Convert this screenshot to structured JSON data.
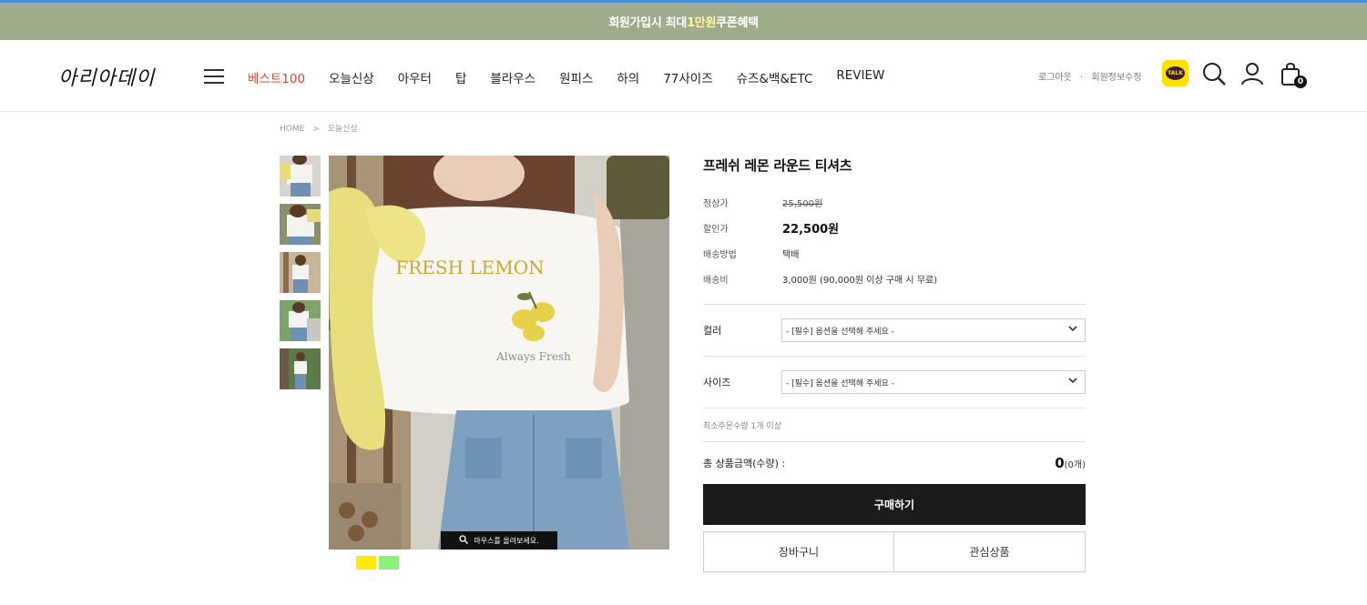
{
  "banner": {
    "text_pre": "회원가입시 최대 ",
    "highlight": "1만원",
    "text_post": " 쿠폰혜택"
  },
  "header": {
    "logo": "아리아데이",
    "nav": [
      "베스트100",
      "오늘신상",
      "아우터",
      "탑",
      "블라우스",
      "원피스",
      "하의",
      "77사이즈",
      "슈즈&백&ETC",
      "REVIEW"
    ],
    "util": {
      "logout": "로그아웃",
      "dot": "·",
      "edit": "회원정보수정"
    },
    "talk_label": "TALK",
    "cart_count": "0"
  },
  "breadcrumb": {
    "home": "HOME",
    "sep": ">",
    "current": "오늘신상"
  },
  "gallery": {
    "zoom_hint": "마우스를 올려보세요.",
    "shirt_text_1": "FRESH LEMON",
    "shirt_text_2": "Always Fresh",
    "swatches": [
      "#ffeb00",
      "#8cf07a"
    ]
  },
  "product": {
    "title": "프레쉬 레몬 라운드 티셔츠",
    "rows": [
      {
        "label": "정상가",
        "value": "25,500원"
      },
      {
        "label": "할인가",
        "value": "22,500원"
      },
      {
        "label": "배송방법",
        "value": "택배"
      },
      {
        "label": "배송비",
        "value": "3,000원 (90,000원 이상 구매 시 무료)"
      }
    ],
    "options": [
      {
        "label": "컬러",
        "placeholder": "- [필수] 옵션을 선택해 주세요 -"
      },
      {
        "label": "사이즈",
        "placeholder": "- [필수] 옵션을 선택해 주세요 -"
      }
    ],
    "min_order": "최소주문수량 1개 이상",
    "total_label": "총 상품금액(수량) :",
    "total_amount": "0",
    "total_count": "(0개)",
    "buy_label": "구매하기",
    "cart_label": "장바구니",
    "wish_label": "관심상품"
  },
  "colors": {
    "banner_bg": "#9fac8b",
    "accent": "#e0422b",
    "buy_bg": "#1b1b1b"
  }
}
